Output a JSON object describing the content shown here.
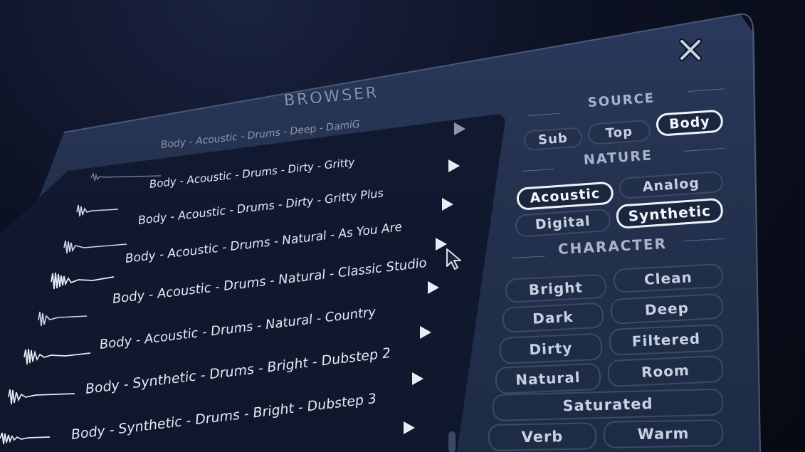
{
  "browser": {
    "title": "BROWSER",
    "rows": [
      {
        "label": "Body - Acoustic - Drums - Deep - DamiG"
      },
      {
        "label": "Body - Acoustic - Drums - Dirty - Gritty"
      },
      {
        "label": "Body - Acoustic - Drums - Dirty - Gritty Plus"
      },
      {
        "label": "Body - Acoustic - Drums - Natural - As You Are"
      },
      {
        "label": "Body - Acoustic - Drums - Natural - Classic Studio"
      },
      {
        "label": "Body - Acoustic - Drums - Natural - Country"
      },
      {
        "label": "Body - Synthetic - Drums - Bright - Dubstep 2"
      },
      {
        "label": "Body - Synthetic - Drums - Bright - Dubstep 3"
      }
    ]
  },
  "filters": {
    "source": {
      "heading": "SOURCE",
      "chips": [
        {
          "label": "Sub",
          "selected": false
        },
        {
          "label": "Top",
          "selected": false
        },
        {
          "label": "Body",
          "selected": true
        }
      ]
    },
    "nature": {
      "heading": "NATURE",
      "chips": [
        {
          "label": "Acoustic",
          "selected": true
        },
        {
          "label": "Analog",
          "selected": false
        },
        {
          "label": "Digital",
          "selected": false
        },
        {
          "label": "Synthetic",
          "selected": true
        }
      ]
    },
    "character": {
      "heading": "CHARACTER",
      "chips": [
        {
          "label": "Bright",
          "selected": false
        },
        {
          "label": "Clean",
          "selected": false
        },
        {
          "label": "Dark",
          "selected": false
        },
        {
          "label": "Deep",
          "selected": false
        },
        {
          "label": "Dirty",
          "selected": false
        },
        {
          "label": "Filtered",
          "selected": false
        },
        {
          "label": "Natural",
          "selected": false
        },
        {
          "label": "Room",
          "selected": false
        },
        {
          "label": "Saturated",
          "selected": false
        },
        {
          "label": "Verb",
          "selected": false
        },
        {
          "label": "Warm",
          "selected": false
        }
      ]
    }
  },
  "icons": {
    "close": "close-icon",
    "play": "play-icon",
    "waveform": "waveform-icon",
    "cursor": "mouse-pointer-icon"
  },
  "colors": {
    "panel": "#26344f",
    "list_bg": "#111a31",
    "text": "#e3e9f5",
    "chip_border": "#3d4a66",
    "chip_selected_border": "#eef2f8"
  }
}
